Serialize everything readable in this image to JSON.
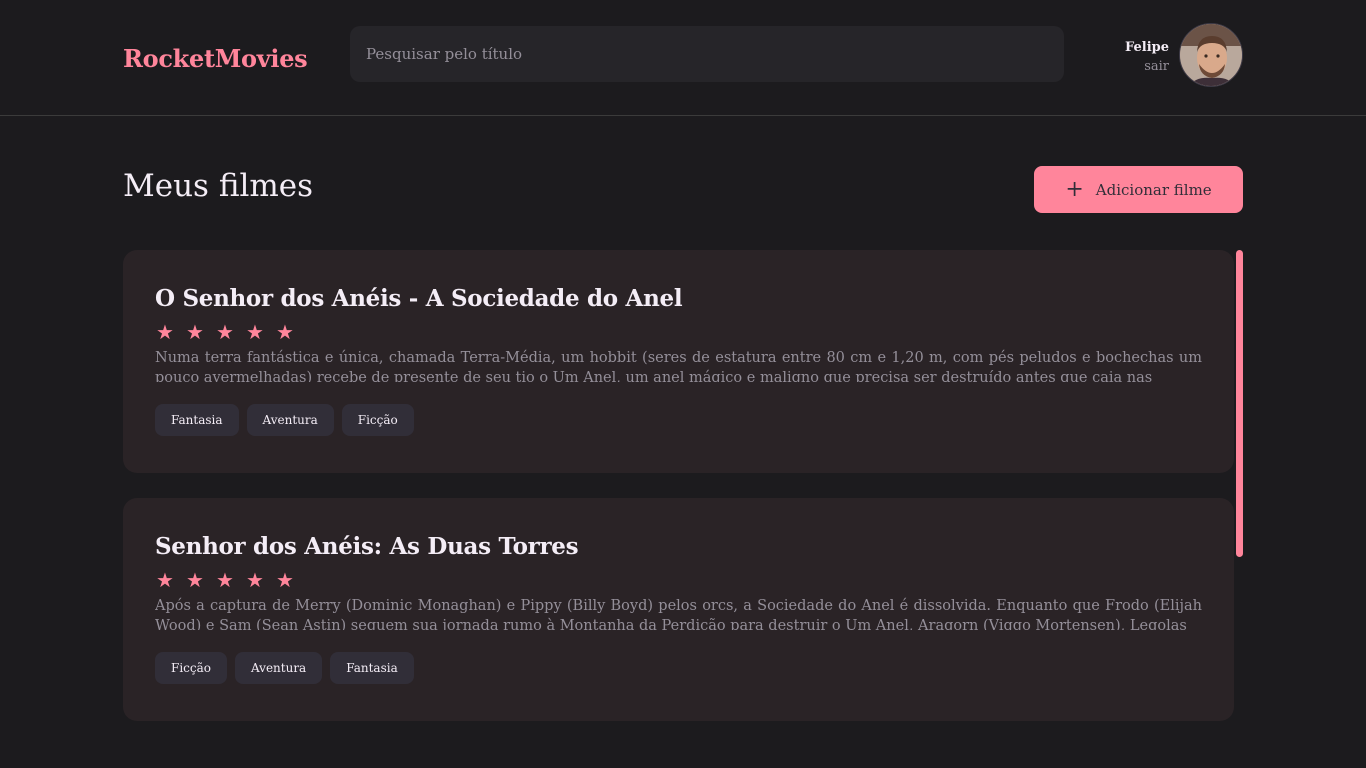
{
  "header": {
    "brand": "RocketMovies",
    "search_placeholder": "Pesquisar pelo título",
    "user_name": "Felipe",
    "logout_label": "sair"
  },
  "main": {
    "title": "Meus filmes",
    "add_button_label": "Adicionar filme",
    "movies": [
      {
        "title": "O Senhor dos Anéis - A Sociedade do Anel",
        "rating": 5,
        "description": "Numa terra fantástica e única, chamada Terra-Média, um hobbit (seres de estatura entre 80 cm e 1,20 m, com pés peludos e bochechas um pouco avermelhadas) recebe de presente de seu tio o Um Anel, um anel mágico e maligno que precisa ser destruído antes que caia nas",
        "tags": [
          "Fantasia",
          "Aventura",
          "Ficção"
        ]
      },
      {
        "title": "Senhor dos Anéis: As Duas Torres",
        "rating": 5,
        "description": "Após a captura de Merry (Dominic Monaghan) e Pippy (Billy Boyd) pelos orcs, a Sociedade do Anel é dissolvida. Enquanto que Frodo (Elijah Wood) e Sam (Sean Astin) seguem sua jornada rumo à Montanha da Perdição para destruir o Um Anel, Aragorn (Viggo Mortensen), Legolas",
        "tags": [
          "Ficção",
          "Aventura",
          "Fantasia"
        ]
      }
    ]
  },
  "colors": {
    "accent": "#ff859b",
    "background": "#1c1b1e",
    "card": "#2a2326",
    "tag": "#312e38",
    "muted_text": "#948f99"
  },
  "icons": {
    "add": "plus-icon",
    "rating": "star-icon"
  }
}
